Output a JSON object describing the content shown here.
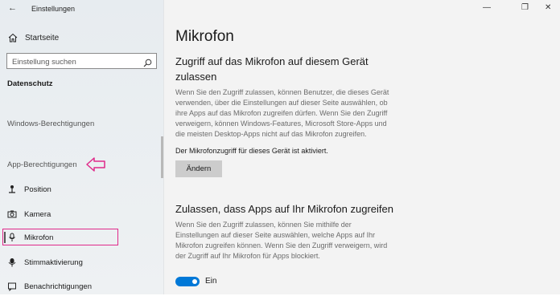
{
  "window": {
    "title": "Einstellungen",
    "back_glyph": "←",
    "minimize_glyph": "—",
    "maximize_glyph": "❐",
    "close_glyph": "✕"
  },
  "sidebar": {
    "home_label": "Startseite",
    "search_placeholder": "Einstellung suchen",
    "section_title": "Datenschutz",
    "group_windows": "Windows-Berechtigungen",
    "group_apps": "App-Berechtigungen",
    "items": [
      {
        "label": "Position",
        "icon": "location-icon"
      },
      {
        "label": "Kamera",
        "icon": "camera-icon"
      },
      {
        "label": "Mikrofon",
        "icon": "microphone-icon",
        "selected": true
      },
      {
        "label": "Stimmaktivierung",
        "icon": "voice-icon"
      },
      {
        "label": "Benachrichtigungen",
        "icon": "notifications-icon"
      }
    ]
  },
  "main": {
    "title": "Mikrofon",
    "section1": {
      "heading_line1": "Zugriff auf das Mikrofon auf diesem Gerät",
      "heading_line2": "zulassen",
      "desc_lines": [
        "Wenn Sie den Zugriff zulassen, können Benutzer, die dieses Gerät",
        "verwenden, über die Einstellungen auf dieser Seite auswählen, ob",
        "ihre Apps auf das Mikrofon zugreifen dürfen. Wenn Sie den Zugriff",
        "verweigern, können Windows-Features, Microsoft Store-Apps und",
        "die meisten Desktop-Apps nicht auf das Mikrofon zugreifen."
      ],
      "status": "Der Mikrofonzugriff für dieses Gerät ist aktiviert.",
      "button_label": "Ändern"
    },
    "section2": {
      "heading": "Zulassen, dass Apps auf Ihr Mikrofon zugreifen",
      "desc_lines": [
        "Wenn Sie den Zugriff zulassen, können Sie mithilfe der",
        "Einstellungen auf dieser Seite auswählen, welche Apps auf Ihr",
        "Mikrofon zugreifen können. Wenn Sie den Zugriff verweigern, wird",
        "der Zugriff auf Ihr Mikrofon für Apps blockiert."
      ],
      "toggle_state": "on",
      "toggle_label": "Ein"
    }
  },
  "colors": {
    "accent": "#0078d7",
    "annotation": "#e0298a"
  }
}
